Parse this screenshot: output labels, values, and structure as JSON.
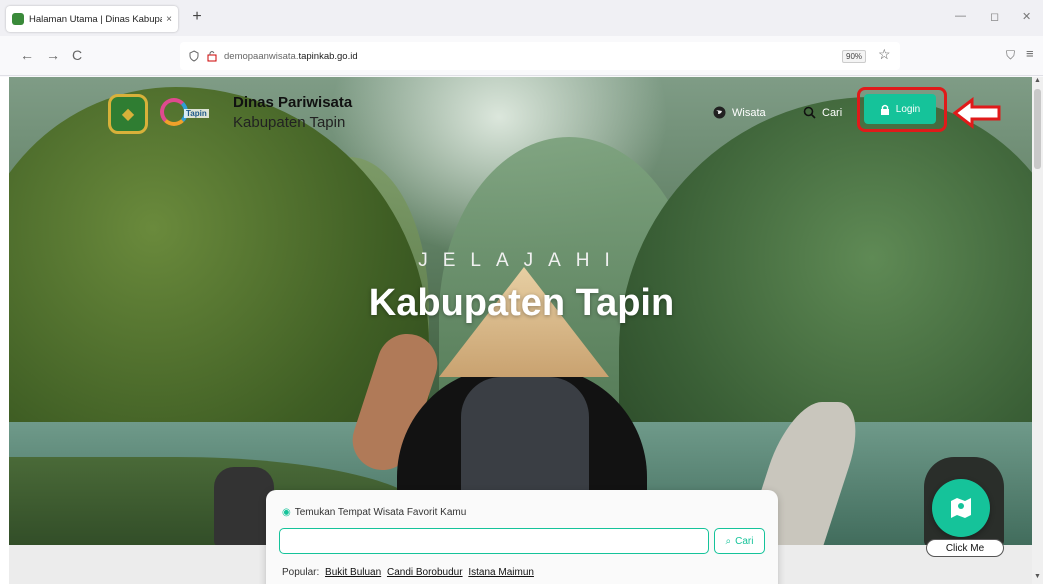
{
  "browser": {
    "tab_title": "Halaman Utama | Dinas Kabupa",
    "tab_close": "×",
    "new_tab": "+",
    "url_prefix": "demopaanwisata.",
    "url_domain": "tapinkab.go.id",
    "zoom": "90%",
    "back": "←",
    "forward": "→",
    "reload": "C",
    "minimize": "—",
    "maximize": "◻",
    "close": "✕",
    "menu": "≡"
  },
  "site": {
    "brand_title": "Dinas Pariwisata",
    "brand_sub": "Kabupaten Tapin",
    "logo2_label": "Tapin",
    "nav": {
      "wisata": "Wisata",
      "cari": "Cari",
      "login": "Login"
    },
    "hero": {
      "kicker": "JELAJAHI",
      "title": "Kabupaten Tapin"
    },
    "search": {
      "label": "Temukan Tempat Wisata Favorit Kamu",
      "placeholder": "",
      "button": "Cari",
      "popular_label": "Popular:",
      "popular": [
        "Bukit Buluan",
        "Candi Borobudur",
        "Istana Maimun"
      ]
    },
    "fab_label": "Click Me"
  },
  "colors": {
    "accent": "#15c39a",
    "highlight": "#e01a1a"
  },
  "icons": {
    "globe": "globe-icon",
    "search": "search-icon",
    "lock": "lock-icon",
    "map": "map-icon",
    "location": "location-pin-icon"
  }
}
